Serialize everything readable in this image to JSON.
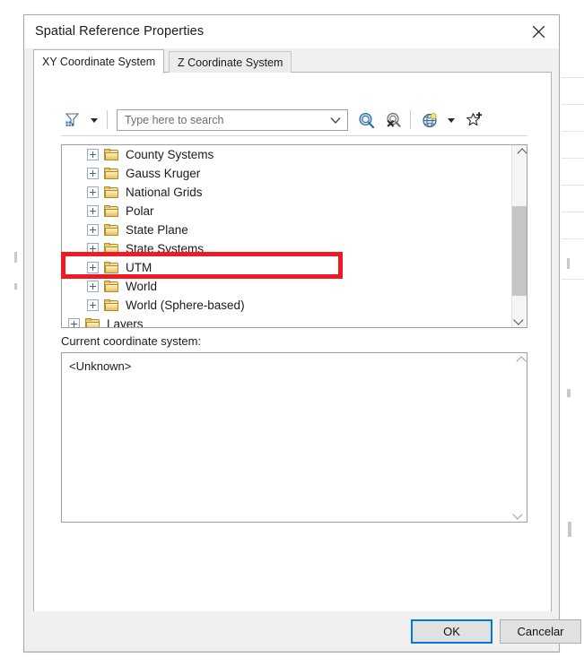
{
  "window": {
    "title": "Spatial Reference Properties",
    "close_icon": "close-icon"
  },
  "tabs": [
    {
      "label": "XY Coordinate System",
      "active": true
    },
    {
      "label": "Z Coordinate System",
      "active": false
    }
  ],
  "toolbar": {
    "filter_icon": "filter-funnel-icon",
    "filter_dropdown_icon": "chevron-down-icon",
    "search": {
      "placeholder": "Type here to search",
      "value": "",
      "dropdown_icon": "chevron-down-icon"
    },
    "search_button_icon": "magnifier-icon",
    "clear_search_button_icon": "magnifier-clear-icon",
    "globe_button_icon": "globe-icon",
    "globe_dropdown_icon": "chevron-down-icon",
    "favorite_button_icon": "star-add-icon"
  },
  "tree": {
    "items": [
      {
        "label": "County Systems",
        "level": 1,
        "expander": "plus"
      },
      {
        "label": "Gauss Kruger",
        "level": 1,
        "expander": "plus"
      },
      {
        "label": "National Grids",
        "level": 1,
        "expander": "plus"
      },
      {
        "label": "Polar",
        "level": 1,
        "expander": "plus"
      },
      {
        "label": "State Plane",
        "level": 1,
        "expander": "plus"
      },
      {
        "label": "State Systems",
        "level": 1,
        "expander": "plus"
      },
      {
        "label": "UTM",
        "level": 1,
        "expander": "plus"
      },
      {
        "label": "World",
        "level": 1,
        "expander": "plus"
      },
      {
        "label": "World (Sphere-based)",
        "level": 1,
        "expander": "plus"
      },
      {
        "label": "Layers",
        "level": 0,
        "expander": "plus"
      }
    ],
    "scrollbar": {
      "up_icon": "chevron-up-icon",
      "down_icon": "chevron-down-icon"
    }
  },
  "current_coordinate_system": {
    "label": "Current coordinate system:",
    "value": "<Unknown>",
    "scroll_up_icon": "chevron-up-icon",
    "scroll_down_icon": "chevron-down-icon"
  },
  "footer": {
    "ok_label": "OK",
    "cancel_label": "Cancelar"
  },
  "annotation": {
    "highlight_color": "#ee1b24",
    "highlight_target": "UTM"
  }
}
